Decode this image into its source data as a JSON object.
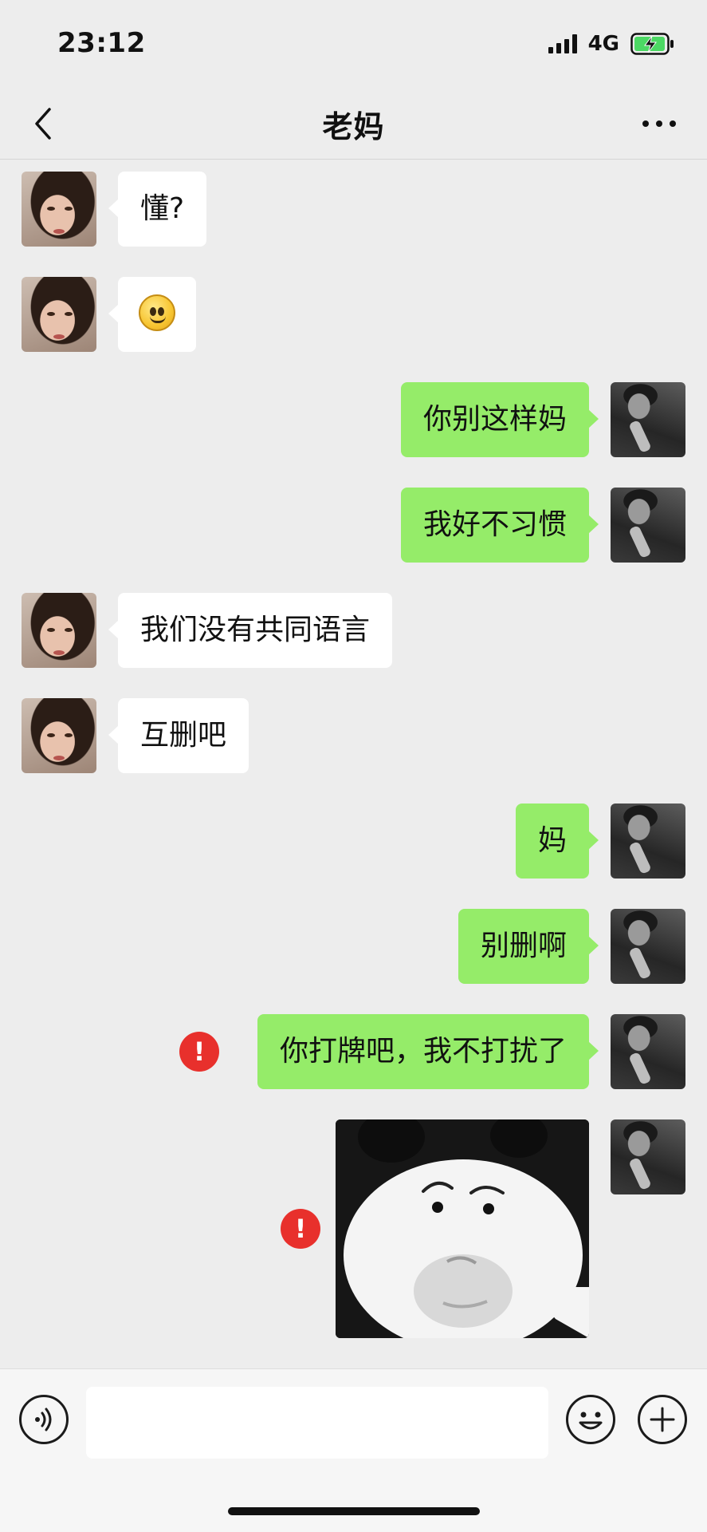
{
  "status_bar": {
    "time": "23:12",
    "network": "4G",
    "battery_state": "charging"
  },
  "nav": {
    "title": "老妈",
    "back_icon": "chevron-left-icon",
    "more_icon": "more-dots-icon"
  },
  "messages": [
    {
      "side": "in",
      "text": "懂?"
    },
    {
      "side": "in",
      "type": "emoji",
      "emoji": "smile-emoji"
    },
    {
      "side": "out",
      "text": "你别这样妈"
    },
    {
      "side": "out",
      "text": "我好不习惯"
    },
    {
      "side": "in",
      "text": "我们没有共同语言"
    },
    {
      "side": "in",
      "text": "互删吧"
    },
    {
      "side": "out",
      "text": "妈"
    },
    {
      "side": "out",
      "text": "别删啊"
    },
    {
      "side": "out",
      "text": "你打牌吧，我不打扰了",
      "failed": true
    },
    {
      "side": "out",
      "type": "sticker",
      "sticker": "panda-meme-sticker",
      "failed": true
    }
  ],
  "error_glyph": "!",
  "input_bar": {
    "voice_icon": "voice-icon",
    "text_value": "",
    "emoji_icon": "emoji-icon",
    "plus_icon": "plus-icon"
  },
  "colors": {
    "outgoing_bubble": "#95ec69",
    "incoming_bubble": "#ffffff",
    "error": "#e8302c",
    "background": "#ededed"
  }
}
